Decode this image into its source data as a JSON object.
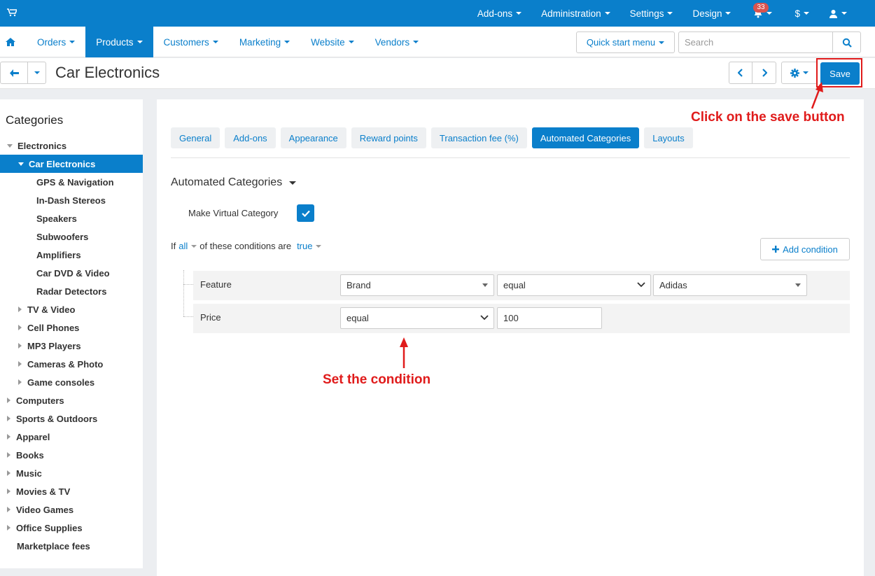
{
  "topbar": {
    "menu": [
      {
        "label": "Add-ons"
      },
      {
        "label": "Administration"
      },
      {
        "label": "Settings"
      },
      {
        "label": "Design"
      }
    ],
    "notifications_count": "33",
    "currency": "$"
  },
  "navbar": {
    "items": [
      {
        "label": "Orders",
        "active": false
      },
      {
        "label": "Products",
        "active": true
      },
      {
        "label": "Customers",
        "active": false
      },
      {
        "label": "Marketing",
        "active": false
      },
      {
        "label": "Website",
        "active": false
      },
      {
        "label": "Vendors",
        "active": false
      }
    ],
    "quick_start": "Quick start menu",
    "search_placeholder": "Search"
  },
  "toolbar": {
    "title": "Car Electronics",
    "save_label": "Save"
  },
  "sidebar": {
    "title": "Categories",
    "tree": [
      {
        "label": "Electronics",
        "level": 0,
        "toggle": "expanded"
      },
      {
        "label": "Car Electronics",
        "level": 1,
        "toggle": "expanded",
        "selected": true
      },
      {
        "label": "GPS & Navigation",
        "level": 2,
        "toggle": "none"
      },
      {
        "label": "In-Dash Stereos",
        "level": 2,
        "toggle": "none"
      },
      {
        "label": "Speakers",
        "level": 2,
        "toggle": "none"
      },
      {
        "label": "Subwoofers",
        "level": 2,
        "toggle": "none"
      },
      {
        "label": "Amplifiers",
        "level": 2,
        "toggle": "none"
      },
      {
        "label": "Car DVD & Video",
        "level": 2,
        "toggle": "none"
      },
      {
        "label": "Radar Detectors",
        "level": 2,
        "toggle": "none"
      },
      {
        "label": "TV & Video",
        "level": 1,
        "toggle": "collapsed"
      },
      {
        "label": "Cell Phones",
        "level": 1,
        "toggle": "collapsed"
      },
      {
        "label": "MP3 Players",
        "level": 1,
        "toggle": "collapsed"
      },
      {
        "label": "Cameras & Photo",
        "level": 1,
        "toggle": "collapsed"
      },
      {
        "label": "Game consoles",
        "level": 1,
        "toggle": "collapsed"
      },
      {
        "label": "Computers",
        "level": 0,
        "toggle": "collapsed"
      },
      {
        "label": "Sports & Outdoors",
        "level": 0,
        "toggle": "collapsed"
      },
      {
        "label": "Apparel",
        "level": 0,
        "toggle": "collapsed"
      },
      {
        "label": "Books",
        "level": 0,
        "toggle": "collapsed"
      },
      {
        "label": "Music",
        "level": 0,
        "toggle": "collapsed"
      },
      {
        "label": "Movies & TV",
        "level": 0,
        "toggle": "collapsed"
      },
      {
        "label": "Video Games",
        "level": 0,
        "toggle": "collapsed"
      },
      {
        "label": "Office Supplies",
        "level": 0,
        "toggle": "collapsed"
      },
      {
        "label": "Marketplace fees",
        "level": 0,
        "toggle": "none"
      }
    ]
  },
  "main": {
    "tabs": [
      {
        "label": "General",
        "active": false
      },
      {
        "label": "Add-ons",
        "active": false
      },
      {
        "label": "Appearance",
        "active": false
      },
      {
        "label": "Reward points",
        "active": false
      },
      {
        "label": "Transaction fee (%)",
        "active": false
      },
      {
        "label": "Automated Categories",
        "active": true
      },
      {
        "label": "Layouts",
        "active": false
      }
    ],
    "section_title": "Automated Categories",
    "virtual_label": "Make Virtual Category",
    "virtual_checked": true,
    "condition_prefix": "If",
    "condition_all": "all",
    "condition_middle": "of these conditions are",
    "condition_true": "true",
    "add_condition": "Add condition",
    "rows": [
      {
        "label": "Feature",
        "field1": "Brand",
        "operator": "equal",
        "value": "Adidas"
      },
      {
        "label": "Price",
        "operator": "equal",
        "value": "100"
      }
    ]
  },
  "annotations": {
    "save_hint": "Click on the save button",
    "condition_hint": "Set the condition",
    "color": "#e01b1b"
  }
}
